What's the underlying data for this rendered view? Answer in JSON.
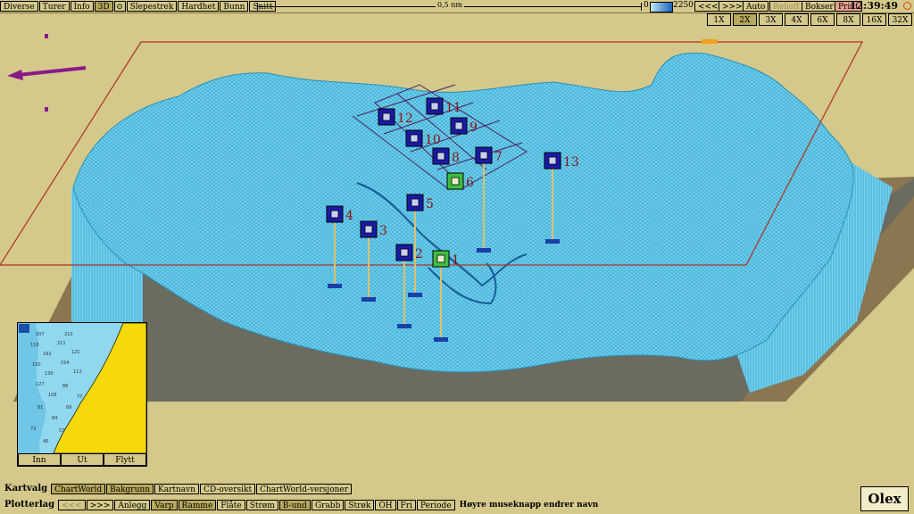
{
  "topbar": {
    "menu": [
      "Diverse",
      "Turer",
      "Info",
      "3D"
    ],
    "menu2": [
      "Slepestrek",
      "Hardhet",
      "Bunn",
      "Snitt"
    ],
    "scale_label": "0,5 nm",
    "depth_min": "0",
    "depth_max": "2250",
    "prev": "<<<",
    "next": ">>>",
    "auto": "Auto",
    "relieff": "Relieff",
    "bokser": "Bokser",
    "print": "Print",
    "clock": "12:39:49"
  },
  "zoom": {
    "options": [
      "1X",
      "2X",
      "3X",
      "4X",
      "6X",
      "8X",
      "16X",
      "32X"
    ],
    "selected": "2X"
  },
  "markers": [
    {
      "label": "1",
      "type": "green"
    },
    {
      "label": "2",
      "type": "blue"
    },
    {
      "label": "3",
      "type": "blue"
    },
    {
      "label": "4",
      "type": "blue"
    },
    {
      "label": "5",
      "type": "blue"
    },
    {
      "label": "6",
      "type": "green"
    },
    {
      "label": "7",
      "type": "blue"
    },
    {
      "label": "8",
      "type": "blue"
    },
    {
      "label": "9",
      "type": "blue"
    },
    {
      "label": "10",
      "type": "blue"
    },
    {
      "label": "11",
      "type": "blue"
    },
    {
      "label": "12",
      "type": "blue"
    },
    {
      "label": "13",
      "type": "blue"
    }
  ],
  "minimap": {
    "buttons": [
      "Inn",
      "Ut",
      "Flytt"
    ],
    "depths": [
      "207",
      "210",
      "118",
      "211",
      "192",
      "121",
      "150",
      "154",
      "130",
      "112",
      "127",
      "86",
      "108",
      "77",
      "81",
      "69",
      "84",
      "73",
      "57",
      "46"
    ]
  },
  "kartvalg": {
    "label": "Kartvalg",
    "items": [
      "ChartWorld",
      "Bakgrunn",
      "Kartnavn",
      "CD-oversikt",
      "ChartWorld-versjoner"
    ]
  },
  "plotterlag": {
    "label": "Plotterlag",
    "prev": "<<<",
    "next": ">>>",
    "items": [
      "Anlegg",
      "Varp",
      "Ramme",
      "Flåte",
      "Strøm",
      "B-und",
      "Grabb",
      "Strøk",
      "OH",
      "Fri",
      "Periode"
    ],
    "hint": "Høyre museknapp endrer navn"
  },
  "brand": "Olex",
  "colors": {
    "terrain": "#5ec7e6",
    "terrain_line": "#2a8fb8",
    "background": "#d4c98a",
    "marker_blue": "#1a1aa8",
    "marker_green": "#3fbf3f",
    "label": "#8b1010",
    "frame": "#b03020"
  }
}
